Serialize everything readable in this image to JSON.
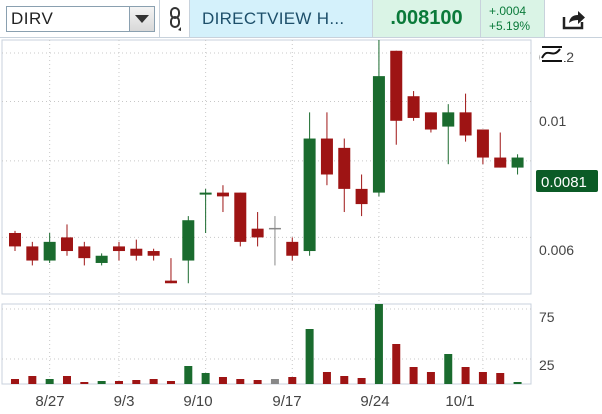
{
  "toolbar": {
    "symbol": "DIRV",
    "description": "DIRECTVIEW H...",
    "last_price": ".008100",
    "change": "+.0004",
    "change_pct": "+5.19%"
  },
  "colors": {
    "up": "#1a6b2e",
    "down": "#9e1414",
    "neutral": "#888888",
    "grid": "#c8c8c8",
    "price_tag_bg": "#0b5b26"
  },
  "icons": [
    "dropdown-arrow-icon",
    "link-icon",
    "share-icon",
    "auto-scale-icon"
  ],
  "price_axis": {
    "tick_labels": [
      "0.012",
      "0.01",
      "0.006"
    ],
    "current_price_label": "0.0081"
  },
  "volume_axis": {
    "tick_labels": [
      "75",
      "25"
    ]
  },
  "x_axis": {
    "tick_labels": [
      "8/27",
      "9/3",
      "9/10",
      "9/17",
      "9/24",
      "10/1"
    ]
  },
  "chart_data": {
    "type": "candlestick",
    "price_scale": "log",
    "price_range": [
      0.00485,
      0.0126
    ],
    "volume_range": [
      0,
      80
    ],
    "candles": [
      {
        "o": 0.0061,
        "h": 0.00615,
        "l": 0.0057,
        "c": 0.0058,
        "v": 5
      },
      {
        "o": 0.0058,
        "h": 0.0059,
        "l": 0.0054,
        "c": 0.0055,
        "v": 8
      },
      {
        "o": 0.0055,
        "h": 0.0061,
        "l": 0.00545,
        "c": 0.0059,
        "v": 5
      },
      {
        "o": 0.006,
        "h": 0.0063,
        "l": 0.0056,
        "c": 0.0057,
        "v": 8
      },
      {
        "o": 0.0058,
        "h": 0.0059,
        "l": 0.0054,
        "c": 0.00555,
        "v": 2
      },
      {
        "o": 0.00545,
        "h": 0.00565,
        "l": 0.0054,
        "c": 0.0056,
        "v": 3
      },
      {
        "o": 0.0058,
        "h": 0.0059,
        "l": 0.0055,
        "c": 0.0057,
        "v": 3
      },
      {
        "o": 0.00575,
        "h": 0.00595,
        "l": 0.0055,
        "c": 0.0056,
        "v": 4
      },
      {
        "o": 0.0057,
        "h": 0.00575,
        "l": 0.0055,
        "c": 0.0056,
        "v": 5
      },
      {
        "o": 0.0051,
        "h": 0.00555,
        "l": 0.00505,
        "c": 0.00505,
        "v": 3
      },
      {
        "o": 0.0055,
        "h": 0.0065,
        "l": 0.00505,
        "c": 0.0064,
        "v": 18
      },
      {
        "o": 0.0071,
        "h": 0.0072,
        "l": 0.0061,
        "c": 0.0071,
        "v": 11
      },
      {
        "o": 0.0071,
        "h": 0.0073,
        "l": 0.0066,
        "c": 0.007,
        "v": 7
      },
      {
        "o": 0.0071,
        "h": 0.0071,
        "l": 0.0058,
        "c": 0.0059,
        "v": 5
      },
      {
        "o": 0.0062,
        "h": 0.0066,
        "l": 0.0058,
        "c": 0.006,
        "v": 4
      },
      {
        "o": 0.0062,
        "h": 0.0065,
        "l": 0.0054,
        "c": 0.0062,
        "v": 5,
        "neutral": true
      },
      {
        "o": 0.0059,
        "h": 0.006,
        "l": 0.0055,
        "c": 0.0056,
        "v": 7
      },
      {
        "o": 0.0057,
        "h": 0.0096,
        "l": 0.0056,
        "c": 0.0087,
        "v": 55
      },
      {
        "o": 0.0087,
        "h": 0.0096,
        "l": 0.0073,
        "c": 0.0076,
        "v": 12
      },
      {
        "o": 0.0084,
        "h": 0.0087,
        "l": 0.0066,
        "c": 0.0072,
        "v": 8
      },
      {
        "o": 0.0072,
        "h": 0.0076,
        "l": 0.0065,
        "c": 0.0068,
        "v": 6
      },
      {
        "o": 0.0071,
        "h": 0.0126,
        "l": 0.007,
        "c": 0.011,
        "v": 80
      },
      {
        "o": 0.0121,
        "h": 0.0121,
        "l": 0.0085,
        "c": 0.0093,
        "v": 40
      },
      {
        "o": 0.0102,
        "h": 0.0104,
        "l": 0.0093,
        "c": 0.0094,
        "v": 17
      },
      {
        "o": 0.0096,
        "h": 0.0096,
        "l": 0.0089,
        "c": 0.009,
        "v": 12
      },
      {
        "o": 0.0091,
        "h": 0.0099,
        "l": 0.0079,
        "c": 0.0096,
        "v": 30
      },
      {
        "o": 0.0096,
        "h": 0.0103,
        "l": 0.0086,
        "c": 0.0088,
        "v": 17
      },
      {
        "o": 0.009,
        "h": 0.009,
        "l": 0.0079,
        "c": 0.0081,
        "v": 12
      },
      {
        "o": 0.0081,
        "h": 0.0089,
        "l": 0.0078,
        "c": 0.0078,
        "v": 11
      },
      {
        "o": 0.0078,
        "h": 0.0082,
        "l": 0.0076,
        "c": 0.0081,
        "v": 2
      }
    ]
  }
}
